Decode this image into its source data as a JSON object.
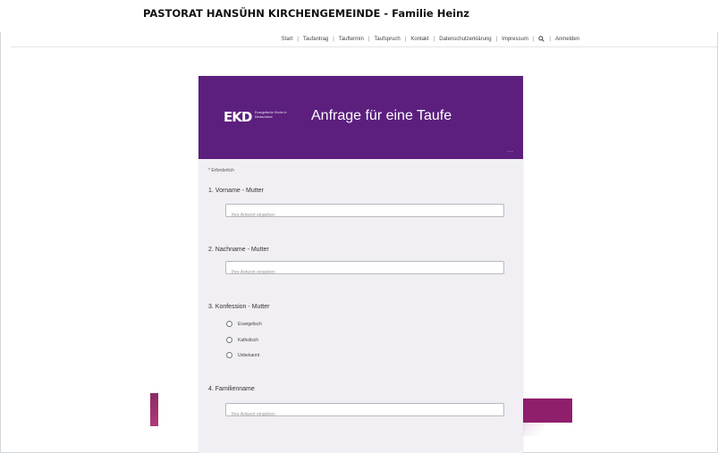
{
  "site": {
    "title": "PASTORAT HANSÜHN KIRCHENGEMEINDE - Familie Heinz"
  },
  "nav": {
    "items": [
      "Start",
      "Taufantrag",
      "Tauftermin",
      "Taufspruch",
      "Kontakt",
      "Datenschutzerklärung",
      "Impressum"
    ],
    "search_icon": "search-icon",
    "login": "Anmelden"
  },
  "form": {
    "logo_text": "EKD",
    "logo_subtitle": "Evangelische Kirche in Deutschland",
    "title": "Anfrage für eine Taufe",
    "more_label": "...",
    "header_color": "#5c1f7e",
    "required_note": "* Erforderlich",
    "questions": [
      {
        "label": "1. Vorname - Mutter",
        "placeholder": "Ihre Antwort eingeben"
      },
      {
        "label": "2. Nachname - Mutter",
        "placeholder": "Ihre Antwort eingeben"
      },
      {
        "label": "3. Konfession - Mutter",
        "options": [
          "Evangelisch",
          "Katholisch",
          "Unbekannt"
        ]
      },
      {
        "label": "4. Familienname",
        "placeholder": "Ihre Antwort eingeben"
      }
    ]
  },
  "colors": {
    "accent": "#8f1f6b",
    "card_bg": "#f1eff4"
  }
}
